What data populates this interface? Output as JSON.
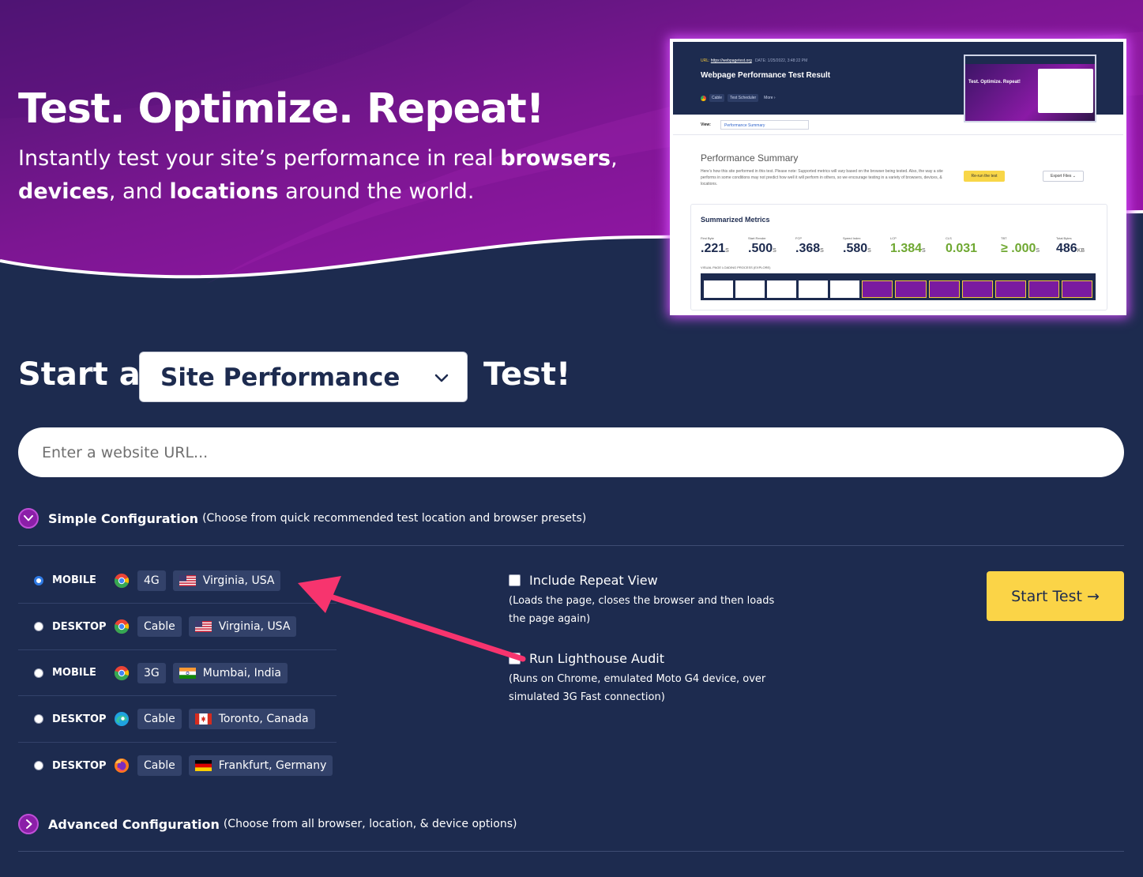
{
  "hero": {
    "title": "Test. Optimize. Repeat!",
    "subtitle_parts": {
      "p1": "Instantly test your site’s performance in real ",
      "b1": "browsers",
      "p2": ",",
      "b2": "devices",
      "p3": ", and ",
      "b3": "locations",
      "p4": " around the world."
    }
  },
  "preview": {
    "url_label": "URL: ",
    "url_value": "https://webpagetest.org",
    "date": "DATE: 1/25/2022, 3:48:22 PM",
    "title": "Webpage Performance Test Result",
    "tags": [
      "Cable",
      "Test Scheduler",
      "More ›"
    ],
    "mini_text": "Test. Optimize. Repeat!",
    "view_label": "View:",
    "view_value": "Performance Summary",
    "summary_title": "Performance Summary",
    "summary_text": "Here’s how this site performed in this test. Please note: Supported metrics will vary based on the browser being tested. Also, the way a site performs in some conditions may not predict how well it will perform in others, so we encourage testing in a variety of browsers, devices, & locations.",
    "rerun_label": "Re-run the test",
    "export_label": "Export Files ⌄",
    "metrics_title": "Summarized Metrics",
    "metrics": [
      {
        "label": "First Byte",
        "value": ".221",
        "unit": "S",
        "good": false
      },
      {
        "label": "Start Render",
        "value": ".500",
        "unit": "S",
        "good": false
      },
      {
        "label": "FCP",
        "value": ".368",
        "unit": "S",
        "good": false
      },
      {
        "label": "Speed Index",
        "value": ".580",
        "unit": "S",
        "good": false
      },
      {
        "label": "LCP",
        "value": "1.384",
        "unit": "S",
        "good": true
      },
      {
        "label": "CLS",
        "value": "0.031",
        "unit": "",
        "good": true
      },
      {
        "label": "TBT",
        "value": "≥ .000",
        "unit": "S",
        "good": true
      },
      {
        "label": "Total Bytes",
        "value": "486",
        "unit": "KB",
        "good": false
      }
    ],
    "visual_label": "VISUAL PAGE LOADING PROCESS (EXPLORE)",
    "frame_count": 12
  },
  "start": {
    "prefix": "Start a",
    "test_type": "Site Performance",
    "suffix": "Test!"
  },
  "url_input": {
    "placeholder": "Enter a website URL...",
    "value": ""
  },
  "simple_config": {
    "title": "Simple Configuration",
    "description": "(Choose from quick recommended test location and browser presets)"
  },
  "presets": [
    {
      "device": "MOBILE",
      "browser": "chrome",
      "connection": "4G",
      "flag": "us",
      "location": "Virginia, USA",
      "selected": true
    },
    {
      "device": "DESKTOP",
      "browser": "chrome",
      "connection": "Cable",
      "flag": "us",
      "location": "Virginia, USA",
      "selected": false
    },
    {
      "device": "MOBILE",
      "browser": "chrome",
      "connection": "3G",
      "flag": "in",
      "location": "Mumbai, India",
      "selected": false
    },
    {
      "device": "DESKTOP",
      "browser": "edge",
      "connection": "Cable",
      "flag": "ca",
      "location": "Toronto, Canada",
      "selected": false
    },
    {
      "device": "DESKTOP",
      "browser": "firefox",
      "connection": "Cable",
      "flag": "de",
      "location": "Frankfurt, Germany",
      "selected": false
    }
  ],
  "options": {
    "repeat_view": {
      "label": "Include Repeat View",
      "description": "(Loads the page, closes the browser and then loads the page again)",
      "checked": false
    },
    "lighthouse": {
      "label": "Run Lighthouse Audit",
      "description": "(Runs on Chrome, emulated Moto G4 device, over simulated 3G Fast connection)",
      "checked": false
    }
  },
  "start_button": "Start Test →",
  "advanced_config": {
    "title": "Advanced Configuration",
    "description": "(Choose from all browser, location, & device options)"
  },
  "colors": {
    "background": "#1d2b4f",
    "accent_purple": "#8b1fa8",
    "button_yellow": "#fbd447",
    "annotation_arrow": "#f7346e"
  }
}
